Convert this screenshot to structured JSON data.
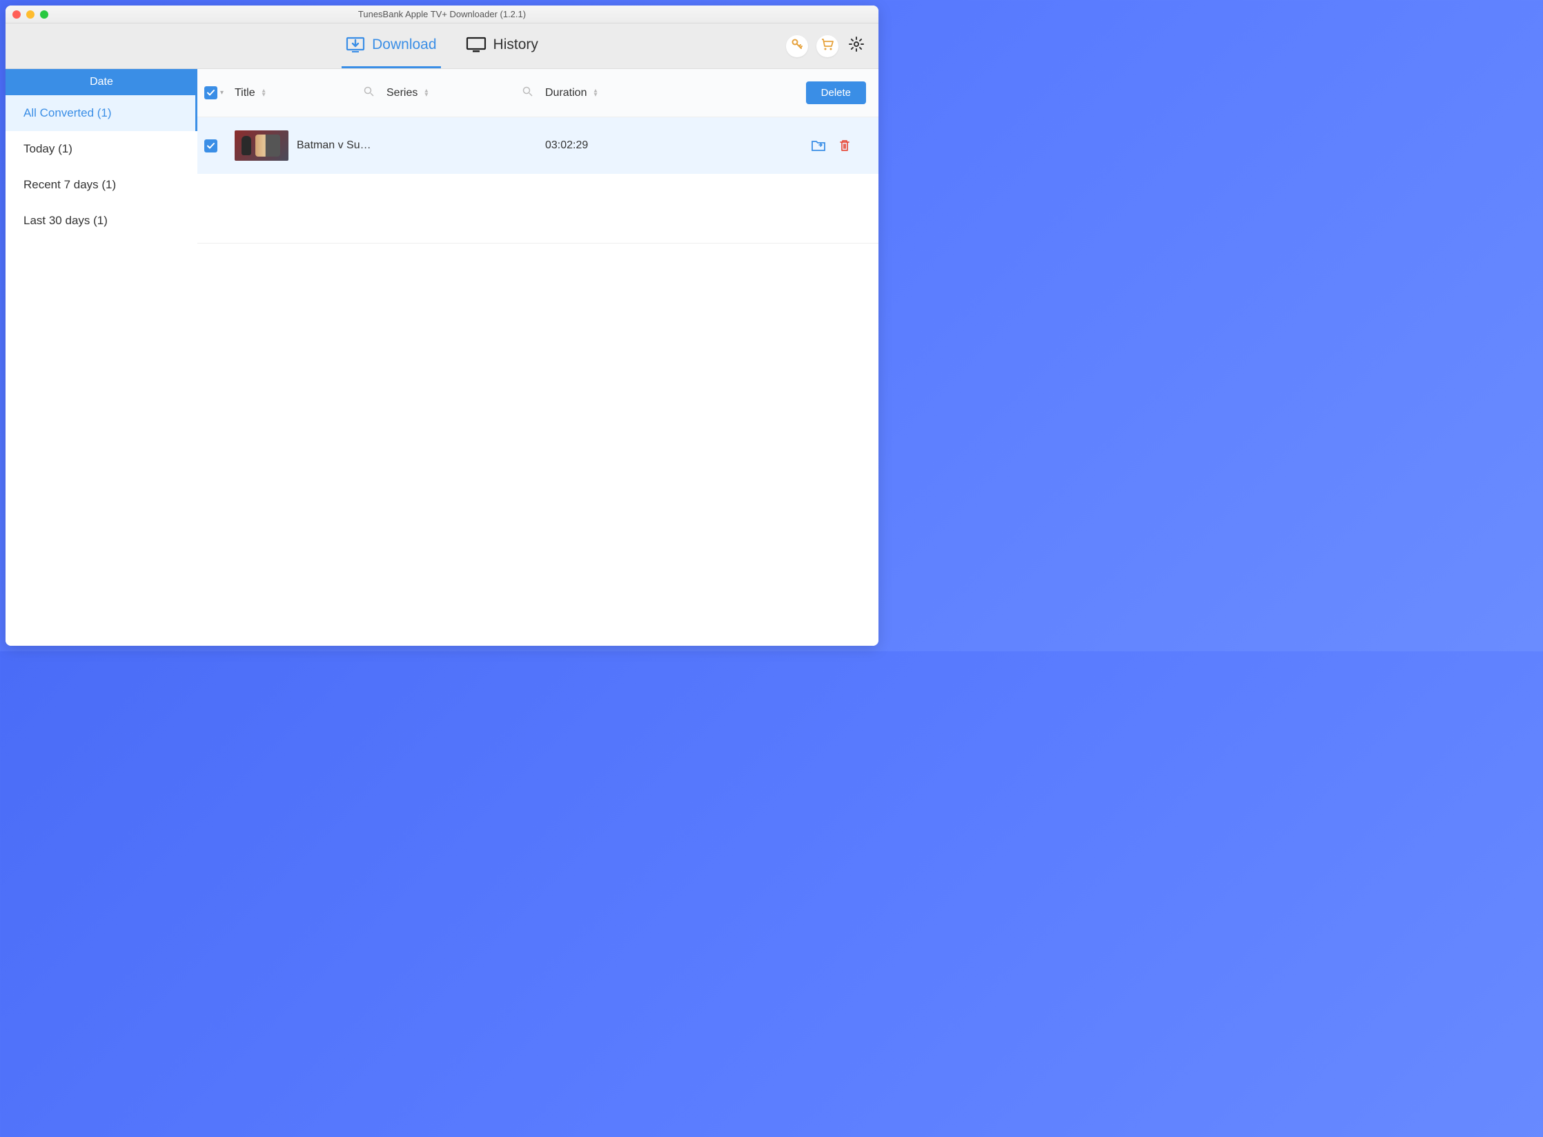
{
  "window": {
    "title": "TunesBank Apple TV+ Downloader (1.2.1)"
  },
  "tabs": {
    "download": "Download",
    "history": "History"
  },
  "sidebar": {
    "header": "Date",
    "items": [
      {
        "label": "All Converted (1)"
      },
      {
        "label": "Today (1)"
      },
      {
        "label": "Recent 7 days (1)"
      },
      {
        "label": "Last 30 days (1)"
      }
    ]
  },
  "table": {
    "headers": {
      "title": "Title",
      "series": "Series",
      "duration": "Duration"
    },
    "delete_label": "Delete",
    "rows": [
      {
        "title": "Batman v Su…",
        "series": "",
        "duration": "03:02:29"
      }
    ]
  }
}
